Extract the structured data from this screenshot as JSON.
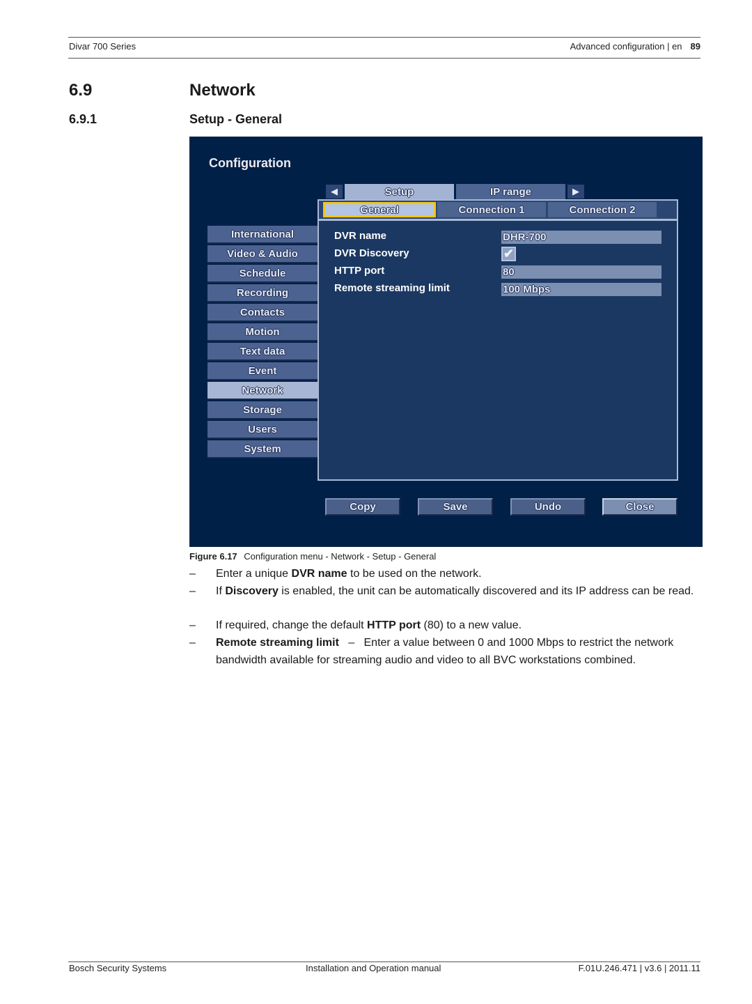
{
  "page_header": {
    "left": "Divar 700 Series",
    "right": "Advanced configuration | en",
    "page_number": "89"
  },
  "section": {
    "number": "6.9",
    "title": "Network"
  },
  "subsection": {
    "number": "6.9.1",
    "title": "Setup - General"
  },
  "config_ui": {
    "title": "Configuration",
    "nav_left_icon": "arrow-left-icon",
    "nav_right_icon": "arrow-right-icon",
    "tabs": [
      {
        "label": "Setup",
        "active": true
      },
      {
        "label": "IP range",
        "active": false
      }
    ],
    "subtabs": [
      {
        "label": "General",
        "active": true
      },
      {
        "label": "Connection 1",
        "active": false
      },
      {
        "label": "Connection 2",
        "active": false
      }
    ],
    "fields": [
      {
        "label": "DVR name",
        "type": "text",
        "value": "DHR-700"
      },
      {
        "label": "DVR Discovery",
        "type": "checkbox",
        "checked": true,
        "glyph": "✔"
      },
      {
        "label": "HTTP port",
        "type": "text",
        "value": "80"
      },
      {
        "label": "Remote streaming limit",
        "type": "text",
        "value": "100 Mbps"
      }
    ],
    "menu": [
      {
        "label": "International",
        "active": false
      },
      {
        "label": "Video & Audio",
        "active": false
      },
      {
        "label": "Schedule",
        "active": false
      },
      {
        "label": "Recording",
        "active": false
      },
      {
        "label": "Contacts",
        "active": false
      },
      {
        "label": "Motion",
        "active": false
      },
      {
        "label": "Text data",
        "active": false
      },
      {
        "label": "Event",
        "active": false
      },
      {
        "label": "Network",
        "active": true
      },
      {
        "label": "Storage",
        "active": false
      },
      {
        "label": "Users",
        "active": false
      },
      {
        "label": "System",
        "active": false
      }
    ],
    "buttons": [
      {
        "label": "Copy"
      },
      {
        "label": "Save"
      },
      {
        "label": "Undo"
      },
      {
        "label": "Close",
        "focused": true
      }
    ],
    "colors": {
      "background": "#002048",
      "panel": "#1b3862",
      "active_tab": "#a3b3d3",
      "inactive_tab": "#4d6592",
      "focus_outline": "#f5c518",
      "field": "#7b8fb1"
    }
  },
  "figure_caption": {
    "label": "Figure",
    "number": "6.17",
    "text": "Configuration menu - Network - Setup - General"
  },
  "bullets": [
    {
      "dash": "–",
      "pre": "Enter a unique ",
      "bold": "DVR name",
      "post": " to be used on the network."
    },
    {
      "dash": "–",
      "pre": "If ",
      "bold": "Discovery",
      "post": " is enabled, the unit can be automatically discovered and its IP address can be read."
    },
    {
      "dash": "–",
      "pre": "If required, change the default ",
      "bold": "HTTP port",
      "post": " (80) to a new value."
    },
    {
      "dash": "–",
      "pre": "",
      "bold": "Remote streaming limit",
      "post": "   –   Enter a value between 0 and 1000 Mbps to restrict the network bandwidth available for streaming audio and video to all BVC workstations combined."
    }
  ],
  "page_footer": {
    "left": "Bosch Security Systems",
    "center": "Installation and Operation manual",
    "right": "F.01U.246.471 | v3.6 | 2011.11"
  }
}
